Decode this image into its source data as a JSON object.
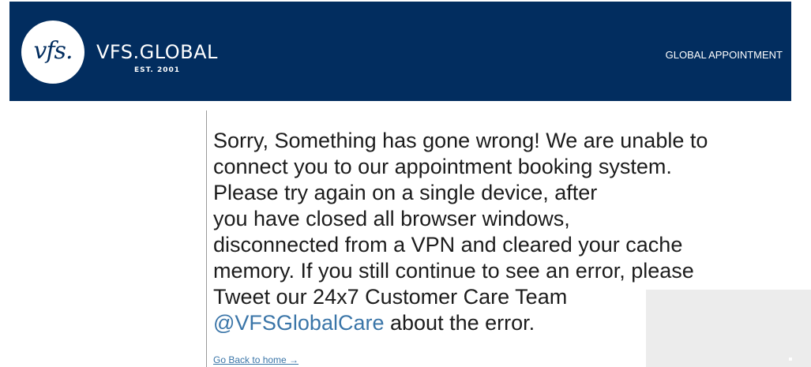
{
  "header": {
    "logo_mark": "vfs.",
    "brand_name": "VFS.GLOBAL",
    "brand_tagline": "EST. 2001",
    "nav_link": "GLOBAL APPOINTMENT",
    "background_color": "#022d5f"
  },
  "error": {
    "lines": [
      "Sorry, Something has gone wrong! We are unable to",
      "connect you to our appointment booking system.",
      "Please try again on a single device, after",
      "you have closed all browser windows,",
      "disconnected from a VPN and cleared your cache",
      "memory. If you still continue to see an error, please",
      "Tweet our 24x7 Customer Care Team"
    ],
    "twitter_handle": "@VFSGlobalCare",
    "closing_text": " about the error.",
    "link_color": "#3a75a8"
  },
  "footer": {
    "home_link": "Go Back to home →"
  }
}
